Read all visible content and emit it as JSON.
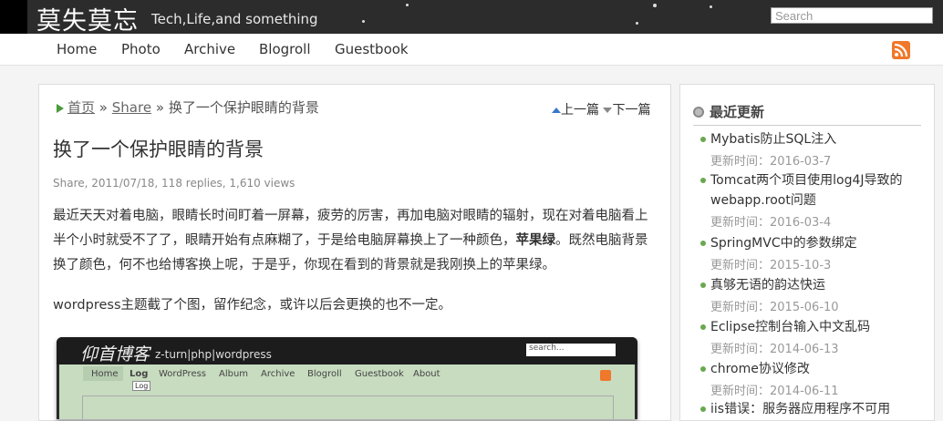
{
  "header": {
    "site_title": "莫失莫忘",
    "tagline": "Tech,Life,and something",
    "search_placeholder": "Search"
  },
  "nav": {
    "items": [
      "Home",
      "Photo",
      "Archive",
      "Blogroll",
      "Guestbook"
    ]
  },
  "breadcrumb": {
    "home": "首页",
    "sep1": "»",
    "category": "Share",
    "sep2": "»",
    "current": "换了一个保护眼睛的背景",
    "prev": "上一篇",
    "next": "下一篇"
  },
  "post": {
    "title": "换了一个保护眼睛的背景",
    "meta": "Share, 2011/07/18, 118 replies, 1,610 views",
    "p1_before": "最近天天对着电脑，眼睛长时间盯着一屏幕，疲劳的厉害，再加电脑对眼睛的辐射，现在对着电脑看上半个小时就受不了了，眼睛开始有点麻糊了，于是给电脑屏幕换上了一种颜色，",
    "p1_bold": "苹果绿",
    "p1_after": "。既然电脑背景换了颜色，何不也给博客换上呢，于是乎，你现在看到的背景就是我刚换上的苹果绿。",
    "p2": "wordpress主题截了个图，留作纪念，或许以后会更换的也不一定。",
    "screenshot": {
      "logo": "仰首博客",
      "tagline": "z-turn|php|wordpress",
      "search": "search...",
      "nav": [
        "Home",
        "Log",
        "WordPress",
        "Album",
        "Archive",
        "Blogroll",
        "Guestbook",
        "About"
      ],
      "tooltip": "Log"
    }
  },
  "sidebar": {
    "heading": "最近更新",
    "date_label": "更新时间：",
    "items": [
      {
        "title": "Mybatis防止SQL注入",
        "date": "2016-03-7"
      },
      {
        "title": "Tomcat两个项目使用log4J导致的webapp.root问题",
        "date": "2016-03-4"
      },
      {
        "title": "SpringMVC中的参数绑定",
        "date": "2015-10-3"
      },
      {
        "title": "真够无语的韵达快运",
        "date": "2015-06-10"
      },
      {
        "title": "Eclipse控制台输入中文乱码",
        "date": "2014-06-13"
      },
      {
        "title": "chrome协议修改",
        "date": "2014-06-11"
      },
      {
        "title": "iis错误：服务器应用程序不可用",
        "date": ""
      }
    ]
  },
  "colors": {
    "topbar": "#2c2c2c",
    "bullet": "#6aa84f",
    "rss": "#f0782a",
    "screenshot_green": "#c8dcc0"
  }
}
